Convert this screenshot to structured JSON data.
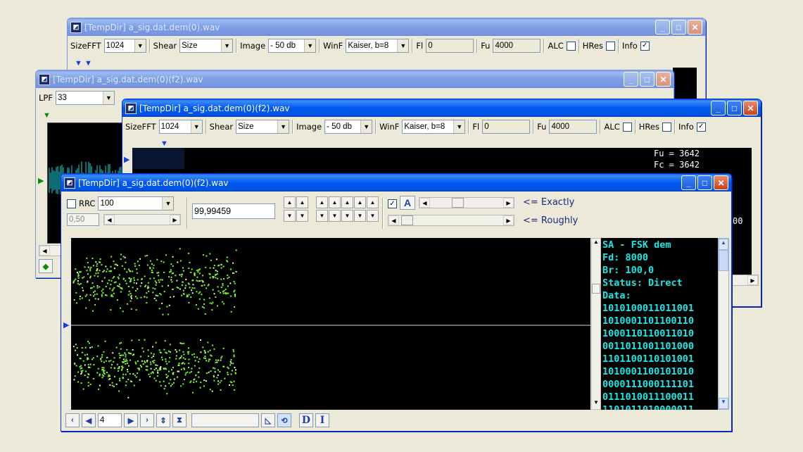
{
  "windows": {
    "w1": {
      "title": "[TempDir] a_sig.dat.dem(0).wav",
      "sizefft_label": "SizeFFT",
      "sizefft_value": "1024",
      "shear_label": "Shear",
      "shear_value": "Size",
      "image_label": "Image",
      "image_value": "- 50 db",
      "winf_label": "WinF",
      "winf_value": "Kaiser, b=8",
      "fl_label": "Fl",
      "fl_value": "0",
      "fu_label": "Fu",
      "fu_value": "4000",
      "alc_label": "ALC",
      "hres_label": "HRes",
      "info_label": "Info"
    },
    "w2": {
      "title": "[TempDir] a_sig.dat.dem(0)(f2).wav",
      "lpf_label": "LPF",
      "lpf_value": "33"
    },
    "w3": {
      "title": "[TempDir] a_sig.dat.dem(0)(f2).wav",
      "sizefft_label": "SizeFFT",
      "sizefft_value": "1024",
      "shear_label": "Shear",
      "shear_value": "Size",
      "image_label": "Image",
      "image_value": "- 50 db",
      "winf_label": "WinF",
      "winf_value": "Kaiser, b=8",
      "fl_label": "Fl",
      "fl_value": "0",
      "fu_label": "Fu",
      "fu_value": "4000",
      "alc_label": "ALC",
      "hres_label": "HRes",
      "info_label": "Info",
      "readout_fu": "Fu = 3642",
      "readout_fc": "Fc = 3642",
      "readout_partial": "00"
    },
    "w4": {
      "title": "[TempDir] a_sig.dat.dem(0)(f2).wav",
      "rrc_label": "RRC",
      "rrc_value": "100",
      "rolloff_value": "0,50",
      "rate_value": "99,99459",
      "a_label": "A",
      "exactly_label": "<= Exactly",
      "roughly_label": "<= Roughly",
      "info_lines": [
        "SA - FSK dem",
        "Fd: 8000",
        "Br: 100,0",
        "Status: Direct",
        "Data:",
        "1010100011011001",
        "1010001101100110",
        "1000110110011010",
        "0011011001101000",
        "1101100110101001",
        "1010001100101010",
        "0000111000111101",
        "0111010011100011",
        "1101011010000011"
      ],
      "page_value": "4",
      "d_label": "D",
      "i_label": "I"
    }
  },
  "colors": {
    "scatter": "#7dff2a",
    "info_text": "#1ee6e6"
  }
}
